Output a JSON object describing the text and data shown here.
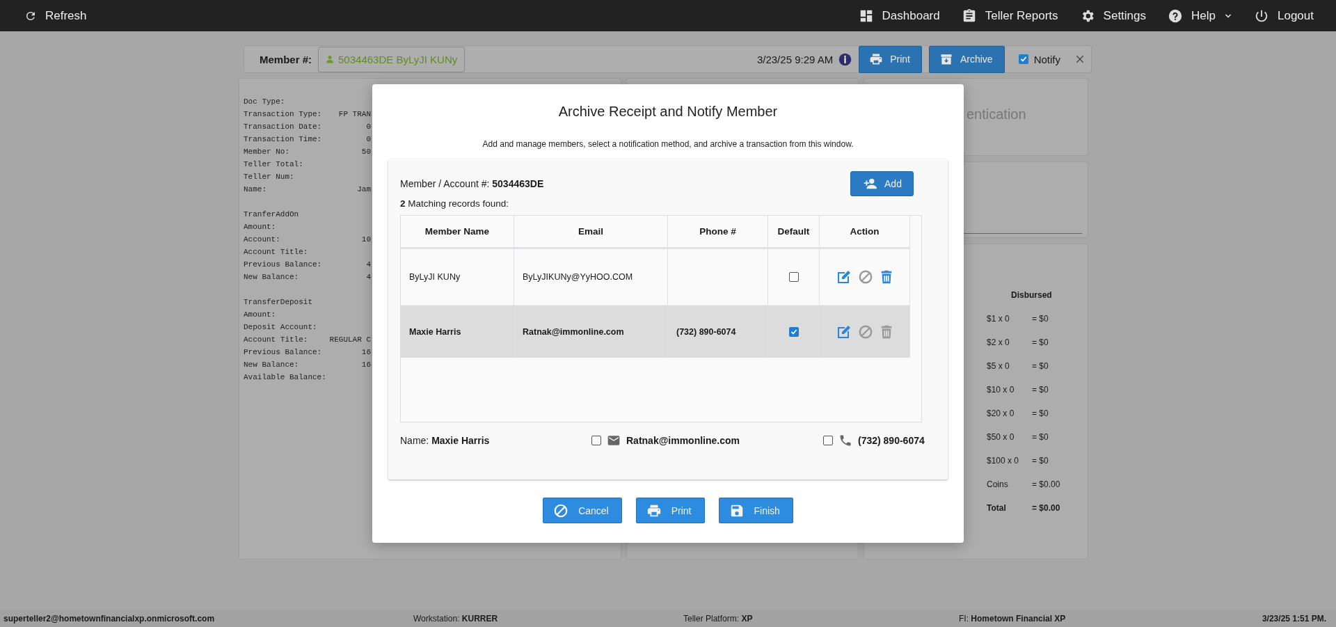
{
  "top_bar": {
    "refresh": "Refresh",
    "nav": [
      {
        "label": "Dashboard",
        "kind": "dashboard",
        "dropdown": false
      },
      {
        "label": "Teller Reports",
        "kind": "reports",
        "dropdown": false
      },
      {
        "label": "Settings",
        "kind": "settings",
        "dropdown": false
      },
      {
        "label": "Help",
        "kind": "help",
        "dropdown": true
      },
      {
        "label": "Logout",
        "kind": "logout",
        "dropdown": false
      }
    ]
  },
  "member_bar": {
    "label": "Member #:",
    "member": "5034463DE ByLyJI KUNy",
    "timestamp": "3/23/25 9:29 AM",
    "buttons": [
      {
        "label": "Print",
        "kind": "print"
      },
      {
        "label": "Archive",
        "kind": "archive"
      }
    ],
    "notify": {
      "label": "Notify",
      "checked": true
    }
  },
  "receipt": {
    "sections": [
      {
        "lines": [
          {
            "label": "Doc Type:"
          },
          {
            "label": "Transaction Type:",
            "value": "FP TRAN"
          },
          {
            "label": "Transaction Date:",
            "value": "0"
          },
          {
            "label": "Transaction Time:",
            "value": "0"
          },
          {
            "label": "Member No:",
            "value": "50"
          },
          {
            "label": "Teller Total:"
          },
          {
            "label": "Teller Num:"
          },
          {
            "label": "Name:",
            "value": "Jam"
          }
        ]
      },
      {
        "heading": "TranferAddOn",
        "lines": [
          {
            "label": "Amount:"
          },
          {
            "label": "Account:",
            "value": "10"
          },
          {
            "label": "Account Title:"
          },
          {
            "label": "Previous Balance:",
            "value": "4"
          },
          {
            "label": "New Balance:",
            "value": "4"
          }
        ]
      },
      {
        "heading": "TransferDeposit",
        "lines": [
          {
            "label": "Amount:"
          },
          {
            "label": "Deposit Account:"
          },
          {
            "label": "Account Title:",
            "value": "REGULAR C"
          },
          {
            "label": "Previous Balance:",
            "value": "16"
          },
          {
            "label": "New Balance:",
            "value": "16"
          },
          {
            "label": "Available Balance:"
          }
        ]
      }
    ]
  },
  "auth_card": {
    "title": "entication"
  },
  "disbursed": {
    "heading": "Disbursed",
    "rows": [
      {
        "denomination": "$1 x 0",
        "amount": "= $0",
        "kind": "line"
      },
      {
        "denomination": "$2 x 0",
        "amount": "= $0",
        "kind": "line"
      },
      {
        "denomination": "$5 x 0",
        "amount": "= $0",
        "kind": "line"
      },
      {
        "denomination": "$10 x 0",
        "amount": "= $0",
        "kind": "line"
      },
      {
        "denomination": "$20 x 0",
        "amount": "= $0",
        "kind": "line"
      },
      {
        "denomination": "$50 x 0",
        "amount": "= $0",
        "kind": "line"
      },
      {
        "denomination": "$100 x 0",
        "amount": "= $0",
        "kind": "line"
      },
      {
        "denomination": "Coins",
        "amount": "= $0.00",
        "kind": "line"
      },
      {
        "denomination": "Total",
        "amount": "= $0.00",
        "kind": "total"
      }
    ]
  },
  "modal": {
    "title": "Archive Receipt and Notify Member",
    "subtitle": "Add and manage members, select a notification method, and archive a transaction from this window.",
    "account_label": "Member / Account #:",
    "account": "5034463DE",
    "add_button": "Add",
    "match_count": "2",
    "match_text": "Matching records found:",
    "table": {
      "columns": [
        "Member Name",
        "Email",
        "Phone #",
        "Default",
        "Action"
      ],
      "rows": [
        {
          "name": "ByLyJI KUNy",
          "email": "ByLyJIKUNy@YyHOO.COM",
          "default": false,
          "selected": false,
          "deletable": true
        },
        {
          "name": "Maxie Harris",
          "email": "Ratnak@immonline.com",
          "phone": "(732) 890-6074",
          "default": true,
          "selected": true,
          "deletable": false
        }
      ]
    },
    "contact": {
      "name_label": "Name:",
      "name": "Maxie Harris",
      "email": {
        "value": "Ratnak@immonline.com",
        "checked": false
      },
      "phone": {
        "value": "(732) 890-6074",
        "checked": false
      }
    },
    "buttons": [
      {
        "label": "Cancel",
        "kind": "cancel"
      },
      {
        "label": "Print",
        "kind": "print"
      },
      {
        "label": "Finish",
        "kind": "finish"
      }
    ]
  },
  "status_bar": {
    "user": "superteller2@hometownfinancialxp.onmicrosoft.com",
    "items": [
      {
        "label": "Workstation:",
        "value": "KURRER"
      },
      {
        "label": "Teller Platform:",
        "value": "XP"
      },
      {
        "label": "FI:",
        "value": "Hometown Financial XP"
      }
    ],
    "datetime": "3/23/25 1:51 PM."
  }
}
